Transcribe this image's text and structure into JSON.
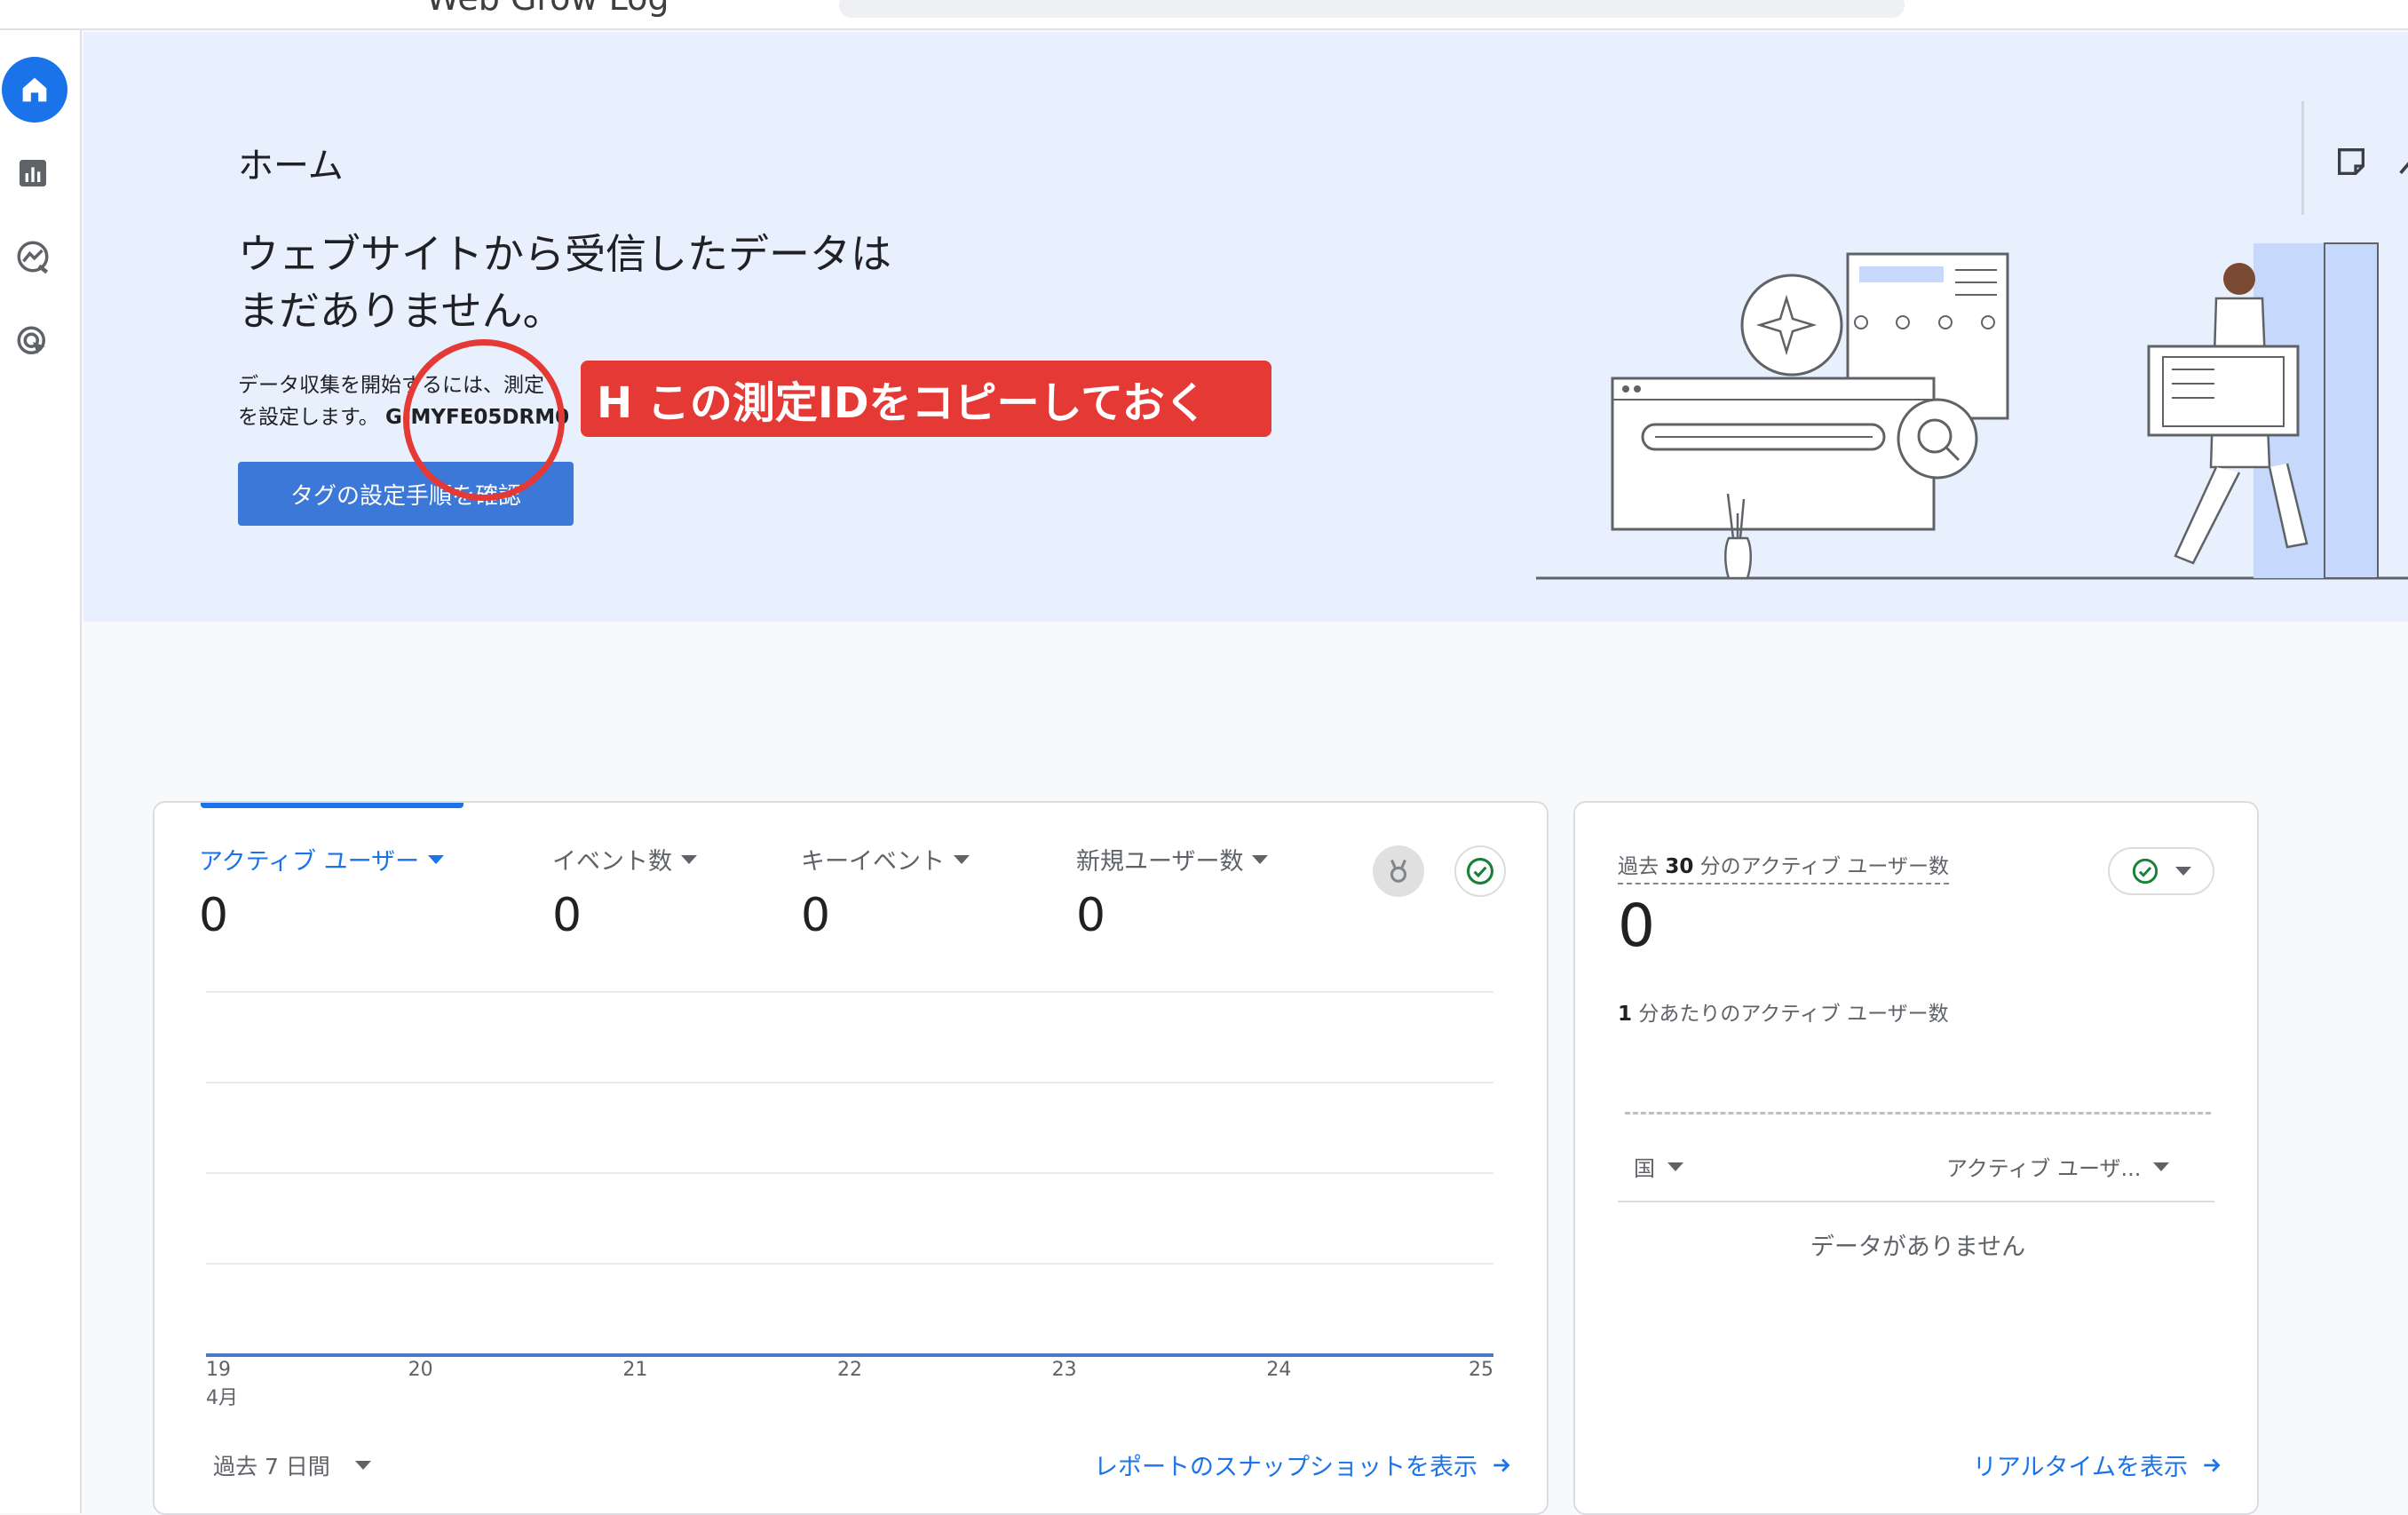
{
  "topbar": {
    "property_title": "Web Grow Log"
  },
  "nav": [
    "home-icon",
    "reports-icon",
    "explore-icon",
    "advertising-icon"
  ],
  "hero": {
    "title": "ホーム",
    "heading_line1": "ウェブサイトから受信したデータは",
    "heading_line2": "まだありません。",
    "desc_part1": "データ収集を開始するには、測定",
    "desc_part2": "を設定します。",
    "measurement_id": "G-MYFE05DRM0",
    "setup_button": "タグの設定手順を確認",
    "annotation": "H この測定IDをコピーしておく"
  },
  "metrics": [
    {
      "label": "アクティブ ユーザー",
      "value": "0"
    },
    {
      "label": "イベント数",
      "value": "0"
    },
    {
      "label": "キーイベント",
      "value": "0"
    },
    {
      "label": "新規ユーザー数",
      "value": "0"
    }
  ],
  "chart_data": {
    "type": "line",
    "x": [
      "19",
      "20",
      "21",
      "22",
      "23",
      "24",
      "25"
    ],
    "x_sublabel": "4月",
    "series": [
      {
        "name": "アクティブ ユーザー",
        "values": [
          0,
          0,
          0,
          0,
          0,
          0,
          0
        ]
      }
    ],
    "grid": true
  },
  "main_footer": {
    "range": "過去 7 日間",
    "link": "レポートのスナップショットを表示"
  },
  "realtime": {
    "title_pre": "過去",
    "title_num": "30",
    "title_post": "分のアクティブ ユーザー数",
    "value": "0",
    "sub_num": "1",
    "sub_text": "分あたりのアクティブ ユーザー数",
    "col_country": "国",
    "col_users": "アクティブ ユーザ...",
    "empty": "データがありません",
    "link": "リアルタイムを表示"
  },
  "colors": {
    "accent": "#1a73e8",
    "hero_bg": "#e8f0fe",
    "annotation": "#e53935"
  }
}
